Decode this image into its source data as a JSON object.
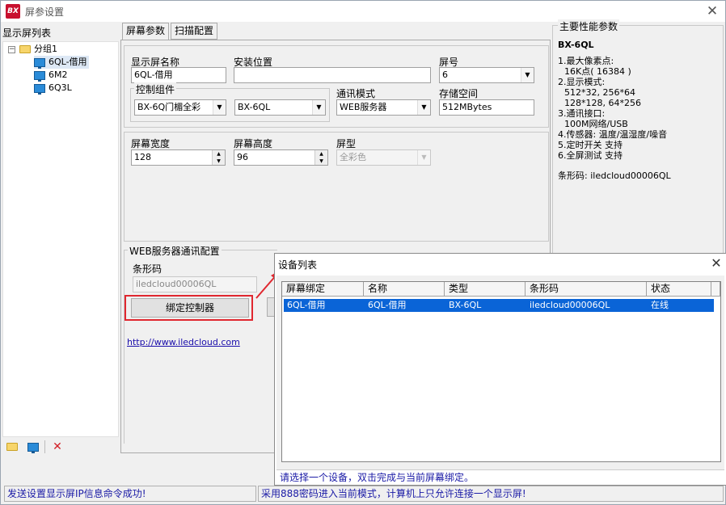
{
  "window": {
    "title": "屏参设置",
    "logo_text": "BX",
    "close_label": "✕"
  },
  "left": {
    "header": "显示屏列表",
    "tree": {
      "group": "分组1",
      "items": [
        "6QL-借用",
        "6M2",
        "6Q3L"
      ]
    }
  },
  "tabs": [
    "屏幕参数",
    "扫描配置"
  ],
  "form": {
    "name_label": "显示屏名称",
    "name_value": "6QL-借用",
    "location_label": "安装位置",
    "location_value": "",
    "screen_no_label": "屏号",
    "screen_no_value": "6",
    "ctrl_group_label": "控制组件",
    "ctrl_series": "BX-6Q门楣全彩",
    "ctrl_model": "BX-6QL",
    "comm_label": "通讯模式",
    "comm_value": "WEB服务器",
    "storage_label": "存储空间",
    "storage_value": "512MBytes",
    "width_label": "屏幕宽度",
    "width_value": "128",
    "height_label": "屏幕高度",
    "height_value": "96",
    "type_label": "屏型",
    "type_value": "全彩色",
    "web_group_label": "WEB服务器通讯配置",
    "barcode_label": "条形码",
    "barcode_value": "iledcloud00006QL",
    "bind_button": "绑定控制器",
    "link": "http://www.iledcloud.com"
  },
  "specs": {
    "title": "主要性能参数",
    "model": "BX-6QL",
    "lines": [
      "1.最大像素点:",
      "   16K点( 16384 )",
      "2.显示模式:",
      "   512*32, 256*64",
      "   128*128, 64*256",
      "3.通讯接口:",
      "   100M网络/USB",
      "4.传感器: 温度/温湿度/噪音",
      "5.定时开关 支持",
      "6.全屏测试 支持"
    ],
    "barcode_line": "条形码: iledcloud00006QL"
  },
  "dialog": {
    "title": "设备列表",
    "close_label": "✕",
    "columns": [
      "屏幕绑定",
      "名称",
      "类型",
      "条形码",
      "状态"
    ],
    "rows": [
      {
        "binding": "6QL-借用",
        "name": "6QL-借用",
        "type": "BX-6QL",
        "barcode": "iledcloud00006QL",
        "status": "在线"
      }
    ],
    "hint": "请选择一个设备，双击完成与当前屏幕绑定。"
  },
  "status": {
    "left": "发送设置显示屏IP信息命令成功!",
    "right": "采用888密码进入当前模式，计算机上只允许连接一个显示屏!"
  },
  "colors": {
    "accent_red": "#e0272f",
    "selection_blue": "#0a64d7",
    "status_text": "#1a1aa6"
  }
}
